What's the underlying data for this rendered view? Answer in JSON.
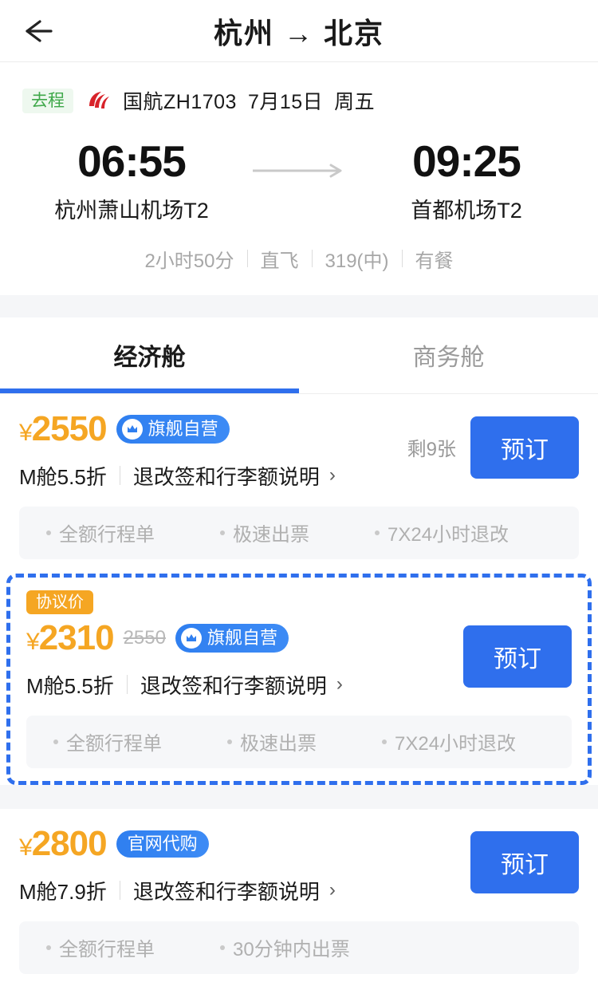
{
  "header": {
    "back_icon": "back-arrow-icon",
    "title": "杭州 → 北京"
  },
  "flight": {
    "trip_tag": "去程",
    "airline_logo": "air-china-logo-icon",
    "flight_name": "国航ZH1703",
    "date": "7月15日",
    "weekday": "周五",
    "depart_time": "06:55",
    "depart_airport": "杭州萧山机场T2",
    "arrow_icon": "arrow-right-icon",
    "arrive_time": "09:25",
    "arrive_airport": "首都机场T2",
    "attributes": [
      "2小时50分",
      "直飞",
      "319(中)",
      "有餐"
    ]
  },
  "tabs": [
    {
      "label": "经济舱",
      "active": true
    },
    {
      "label": "商务舱",
      "active": false
    }
  ],
  "fares": [
    {
      "price": "2550",
      "currency": "¥",
      "old_price": "",
      "agreement_tag": "",
      "badge": "旗舰自营",
      "badge_icon": "crown-icon",
      "cabin": "M舱5.5折",
      "policy_link": "退改签和行李额说明",
      "chevron": "›",
      "seats": "剩9张",
      "book_label": "预订",
      "perks": [
        "全额行程单",
        "极速出票",
        "7X24小时退改"
      ],
      "highlighted": false
    },
    {
      "price": "2310",
      "currency": "¥",
      "old_price": "2550",
      "agreement_tag": "协议价",
      "badge": "旗舰自营",
      "badge_icon": "crown-icon",
      "cabin": "M舱5.5折",
      "policy_link": "退改签和行李额说明",
      "chevron": "›",
      "seats": "",
      "book_label": "预订",
      "perks": [
        "全额行程单",
        "极速出票",
        "7X24小时退改"
      ],
      "highlighted": true
    },
    {
      "price": "2800",
      "currency": "¥",
      "old_price": "",
      "agreement_tag": "",
      "badge": "官网代购",
      "badge_icon": "",
      "cabin": "M舱7.9折",
      "policy_link": "退改签和行李额说明",
      "chevron": "›",
      "seats": "",
      "book_label": "预订",
      "perks": [
        "全额行程单",
        "30分钟内出票"
      ],
      "highlighted": false
    }
  ],
  "colors": {
    "accent_blue": "#2f6fed",
    "price_orange": "#f5a623",
    "tag_green": "#3fa84a",
    "muted_gray": "#a7a7a7"
  }
}
